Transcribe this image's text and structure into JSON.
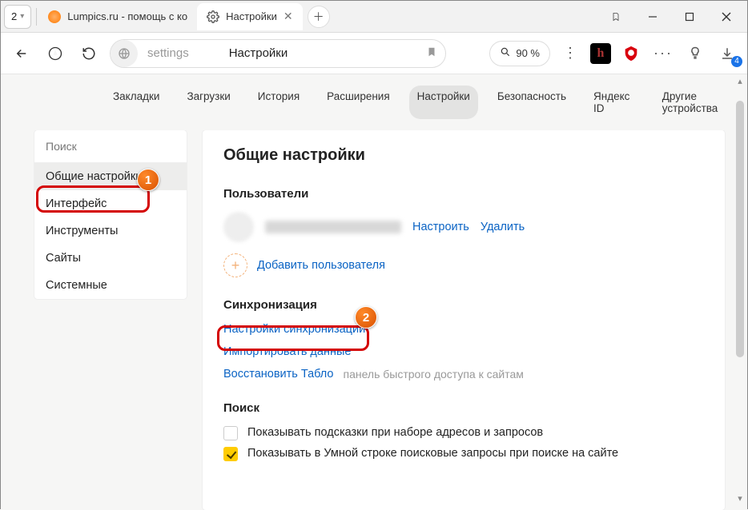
{
  "titlebar": {
    "group_badge": "2",
    "tab1_label": "Lumpics.ru - помощь с ко",
    "tab2_label": "Настройки"
  },
  "nav": {
    "address": "settings",
    "page_title": "Настройки",
    "zoom_label": "90 %",
    "download_count": "4"
  },
  "settings_tabs": {
    "bookmarks": "Закладки",
    "downloads": "Загрузки",
    "history": "История",
    "extensions": "Расширения",
    "settings": "Настройки",
    "security": "Безопасность",
    "yandex_id": "Яндекс ID",
    "other_devices": "Другие устройства"
  },
  "sidebar": {
    "search_placeholder": "Поиск",
    "items": {
      "general": "Общие настройки",
      "interface": "Интерфейс",
      "tools": "Инструменты",
      "sites": "Сайты",
      "system": "Системные"
    }
  },
  "panel": {
    "heading": "Общие настройки",
    "users_heading": "Пользователи",
    "configure": "Настроить",
    "delete": "Удалить",
    "add_user": "Добавить пользователя",
    "sync_heading": "Синхронизация",
    "sync_settings": "Настройки синхронизации",
    "import_data": "Импортировать данные",
    "restore_tablo": "Восстановить Табло",
    "restore_hint": "панель быстрого доступа к сайтам",
    "search_heading": "Поиск",
    "opt_suggest": "Показывать подсказки при наборе адресов и запросов",
    "opt_smartline": "Показывать в Умной строке поисковые запросы при поиске на сайте"
  },
  "annotations": {
    "badge1": "1",
    "badge2": "2"
  }
}
